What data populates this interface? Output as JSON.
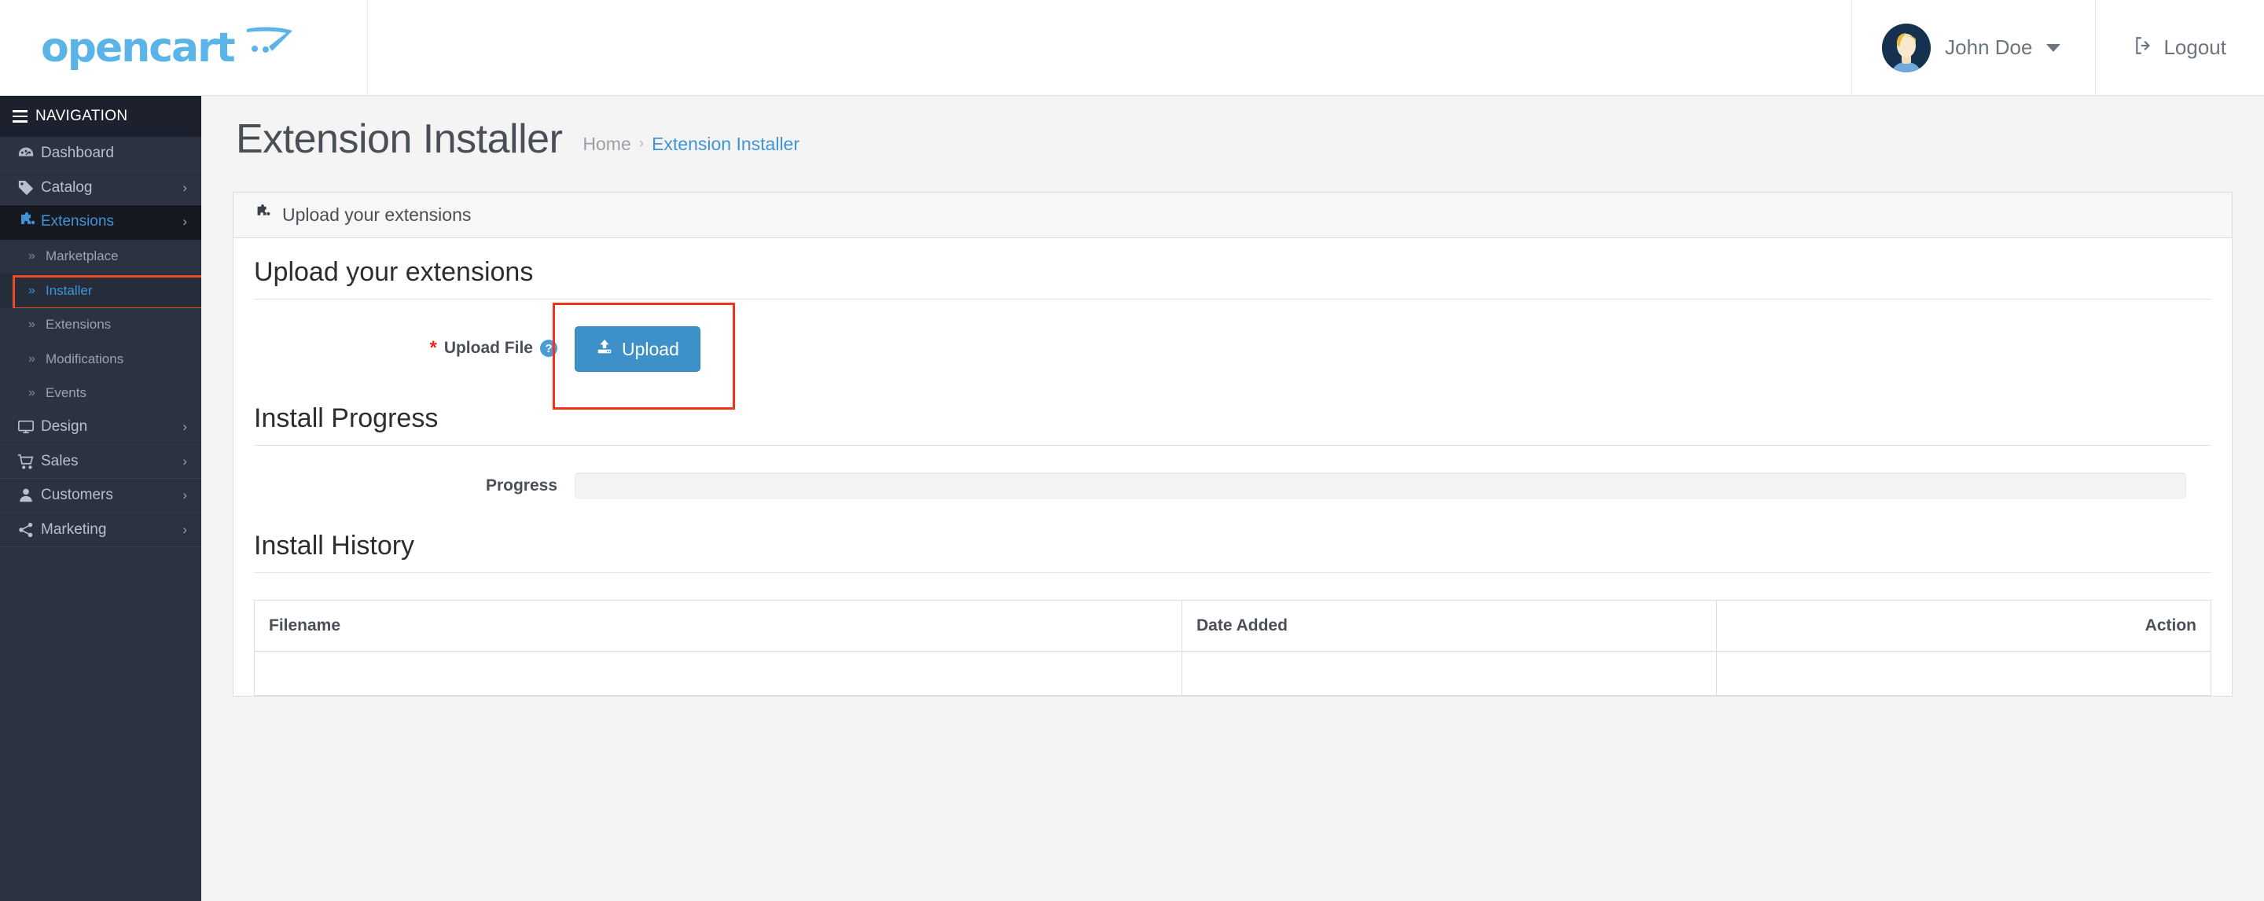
{
  "header": {
    "logo_text": "opencart",
    "logo_icon": "shopping-cart-swoosh-icon",
    "user_name": "John Doe",
    "user_caret_icon": "caret-down-icon",
    "avatar_icon": "user-avatar",
    "logout_label": "Logout",
    "logout_icon": "sign-out-icon"
  },
  "sidebar": {
    "nav_title": "NAVIGATION",
    "menu_icon": "hamburger-icon",
    "items": [
      {
        "label": "Dashboard",
        "icon": "dashboard-gauge-icon",
        "has_chevron": false,
        "active": false
      },
      {
        "label": "Catalog",
        "icon": "tag-icon",
        "has_chevron": true,
        "active": false
      },
      {
        "label": "Extensions",
        "icon": "puzzle-piece-icon",
        "has_chevron": true,
        "active": true
      }
    ],
    "sub_items": [
      {
        "label": "Marketplace",
        "active": false,
        "highlighted": false
      },
      {
        "label": "Installer",
        "active": true,
        "highlighted": true
      },
      {
        "label": "Extensions",
        "active": false,
        "highlighted": false
      },
      {
        "label": "Modifications",
        "active": false,
        "highlighted": false
      },
      {
        "label": "Events",
        "active": false,
        "highlighted": false
      }
    ],
    "items_after": [
      {
        "label": "Design",
        "icon": "monitor-icon",
        "has_chevron": true
      },
      {
        "label": "Sales",
        "icon": "cart-icon",
        "has_chevron": true
      },
      {
        "label": "Customers",
        "icon": "person-icon",
        "has_chevron": true
      },
      {
        "label": "Marketing",
        "icon": "share-nodes-icon",
        "has_chevron": true
      }
    ],
    "chevron_icon": "chevron-right-icon",
    "sub_chevron_icon": "double-chevron-right-icon"
  },
  "page": {
    "title": "Extension Installer",
    "breadcrumb": {
      "home": "Home",
      "separator": "›",
      "current": "Extension Installer"
    }
  },
  "card": {
    "header_title": "Upload your extensions",
    "header_icon": "puzzle-piece-icon",
    "upload_section_title": "Upload your extensions",
    "upload_file_label": "Upload File",
    "required_marker": "*",
    "help_icon_glyph": "?",
    "upload_button_label": "Upload",
    "upload_button_icon": "upload-icon",
    "upload_button_color": "#3d91c8",
    "progress_section_title": "Install Progress",
    "progress_label": "Progress",
    "progress_percent": 0,
    "history_section_title": "Install History",
    "table": {
      "columns": [
        "Filename",
        "Date Added",
        "Action"
      ],
      "rows": []
    }
  },
  "highlights": {
    "installer_box_color": "#f04a22",
    "upload_box_color": "#f0331b"
  }
}
